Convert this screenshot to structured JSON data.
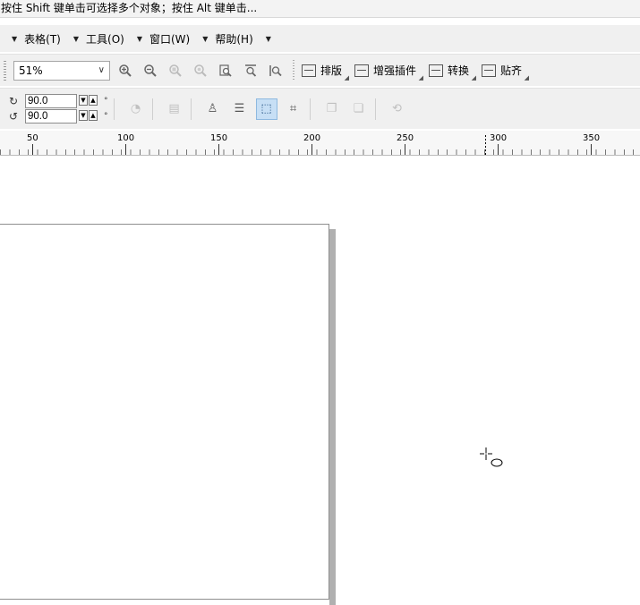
{
  "status": {
    "hint": "按住 Shift 键单击可选择多个对象；按住 Alt 键单击..."
  },
  "menu": [
    {
      "label": "表格(T)"
    },
    {
      "label": "工具(O)"
    },
    {
      "label": "窗口(W)"
    },
    {
      "label": "帮助(H)"
    }
  ],
  "toolbar": {
    "zoom_value": "51%",
    "icons": [
      "zoom-in-icon",
      "zoom-out-icon",
      "zoom-selected-icon",
      "zoom-all-icon",
      "zoom-page-icon",
      "zoom-width-icon",
      "zoom-height-icon"
    ],
    "plugins": [
      {
        "label": "排版"
      },
      {
        "label": "增强插件"
      },
      {
        "label": "转换"
      },
      {
        "label": "贴齐"
      }
    ]
  },
  "property_bar": {
    "angle1": "90.0",
    "angle2": "90.0",
    "degree_symbol": "°"
  },
  "ruler": {
    "labels": [
      "50",
      "100",
      "150",
      "200",
      "250",
      "300",
      "350"
    ]
  }
}
